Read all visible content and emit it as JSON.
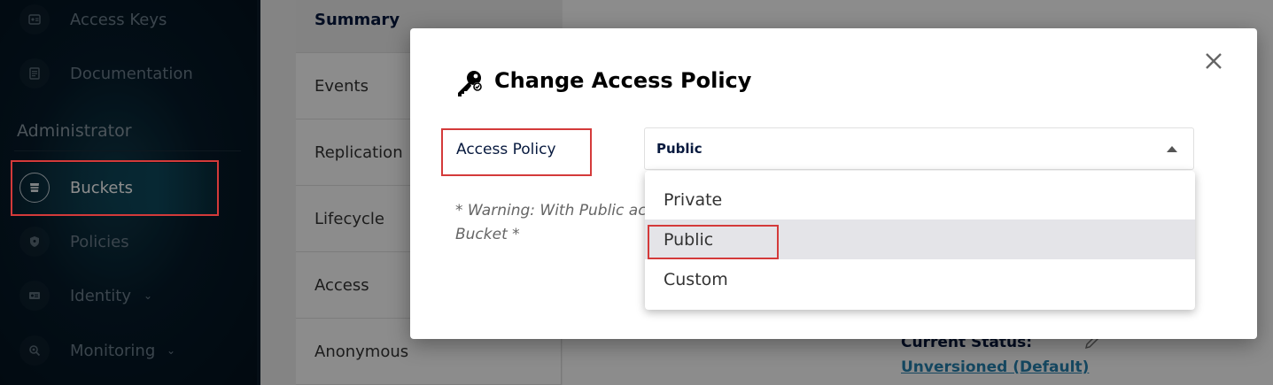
{
  "sidebar": {
    "items_top": [
      {
        "label": "Access Keys",
        "icon": "key-card-icon"
      },
      {
        "label": "Documentation",
        "icon": "document-icon"
      }
    ],
    "section_label": "Administrator",
    "items": [
      {
        "label": "Buckets",
        "icon": "bucket-icon",
        "active": true
      },
      {
        "label": "Policies",
        "icon": "shield-icon"
      },
      {
        "label": "Identity",
        "icon": "id-card-icon",
        "expandable": true
      },
      {
        "label": "Monitoring",
        "icon": "monitor-search-icon",
        "expandable": true
      }
    ]
  },
  "tabs": [
    "Summary",
    "Events",
    "Replication",
    "Lifecycle",
    "Access",
    "Anonymous"
  ],
  "versioning": {
    "status_label": "Current Status:",
    "status_value": "Unversioned (Default)"
  },
  "modal": {
    "title": "Change Access Policy",
    "field_label": "Access Policy",
    "selected_value": "Public",
    "warning_line1": "* Warning: With Public acc",
    "warning_line2": "Bucket *",
    "options": [
      "Private",
      "Public",
      "Custom"
    ],
    "highlighted_option": "Public"
  },
  "colors": {
    "highlight_box": "#d43a3a",
    "sidebar_bg": "#061a29",
    "link": "#2781b0",
    "text_dark": "#07193e"
  }
}
